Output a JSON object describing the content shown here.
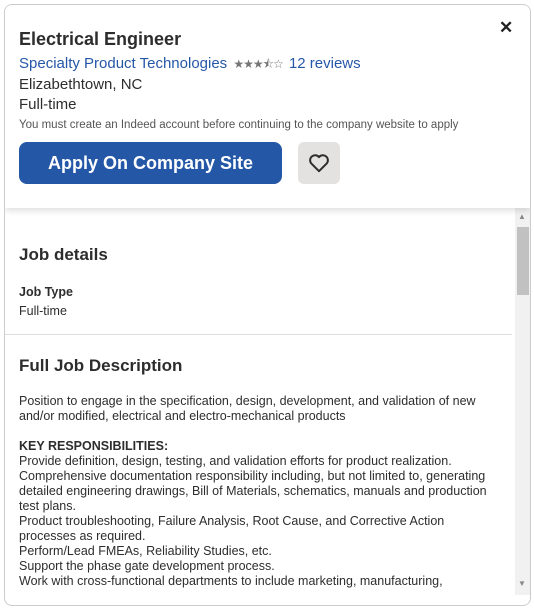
{
  "header": {
    "close_icon": "close-icon",
    "title": "Electrical Engineer",
    "company": "Specialty Product Technologies",
    "rating": 3.5,
    "stars": "★★★⯪☆",
    "reviews": "12 reviews",
    "location": "Elizabethtown, NC",
    "job_type": "Full-time",
    "note": "You must create an Indeed account before continuing to the company website to apply",
    "apply_label": "Apply On Company Site",
    "save_icon": "heart-icon",
    "accent": "#2557a7"
  },
  "details": {
    "heading": "Job details",
    "job_type_label": "Job Type",
    "job_type_value": "Full-time"
  },
  "description": {
    "heading": "Full Job Description",
    "intro": "Position to engage in the specification, design, development, and validation of new and/or modified, electrical and electro-mechanical products",
    "resp_heading": "KEY RESPONSIBILITIES:",
    "items": [
      "Provide definition, design, testing, and validation efforts for product realization.",
      "Comprehensive documentation responsibility including, but not limited to, generating detailed engineering drawings, Bill of Materials, schematics, manuals and production test plans.",
      "Product troubleshooting, Failure Analysis, Root Cause, and Corrective Action processes as required.",
      "Perform/Lead FMEAs, Reliability Studies, etc.",
      "Support the phase gate development process.",
      "Work with cross-functional departments to include marketing, manufacturing,"
    ]
  }
}
